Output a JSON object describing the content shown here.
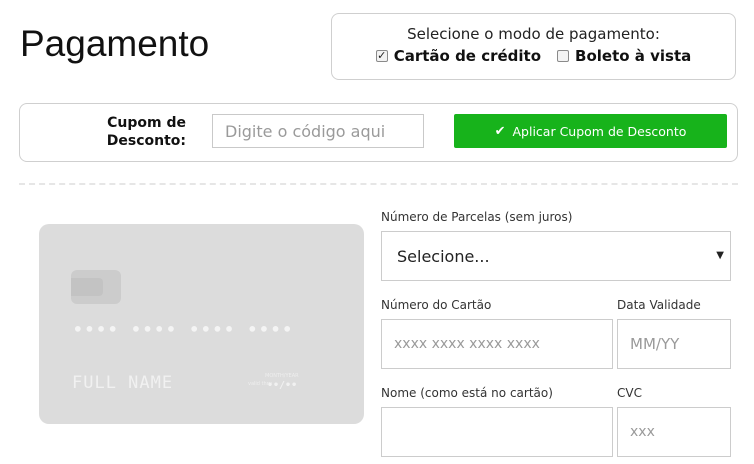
{
  "header": {
    "title": "Pagamento"
  },
  "payment_mode": {
    "prompt": "Selecione o modo de pagamento:",
    "options": [
      {
        "label": "Cartão de crédito",
        "checked": true
      },
      {
        "label": "Boleto à vista",
        "checked": false
      }
    ]
  },
  "coupon": {
    "label_line1": "Cupom de",
    "label_line2": "Desconto:",
    "placeholder": "Digite o código aqui",
    "button_label": "Aplicar Cupom de Desconto",
    "button_color": "#17b31b"
  },
  "card_preview": {
    "number_mask": "•••• •••• •••• ••••",
    "name": "FULL NAME",
    "valid_small": "MONTH/YEAR",
    "valid_big": "valid thru",
    "expiry": "••/••"
  },
  "form": {
    "installments_label": "Número de Parcelas (sem juros)",
    "installments_value": "Selecione...",
    "card_number_label": "Número do Cartão",
    "card_number_placeholder": "xxxx xxxx xxxx xxxx",
    "expiry_label": "Data Validade",
    "expiry_placeholder": "MM/YY",
    "name_label": "Nome (como está no cartão)",
    "name_placeholder": "",
    "cvc_label": "CVC",
    "cvc_placeholder": "xxx"
  }
}
